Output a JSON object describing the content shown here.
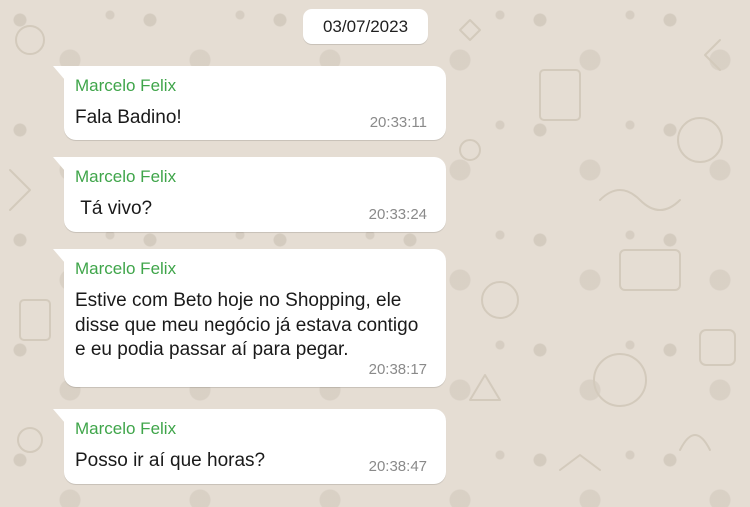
{
  "date_divider": "03/07/2023",
  "messages": [
    {
      "sender": "Marcelo Felix",
      "text": "Fala Badino!",
      "time": "20:33:11"
    },
    {
      "sender": "Marcelo Felix",
      "text": " Tá vivo?",
      "time": "20:33:24"
    },
    {
      "sender": "Marcelo Felix",
      "text": "Estive com Beto hoje no Shopping, ele disse que meu negócio já estava contigo e eu podia passar aí para pegar.",
      "time": "20:38:17"
    },
    {
      "sender": "Marcelo Felix",
      "text": "Posso ir aí que horas?",
      "time": "20:38:47"
    }
  ],
  "colors": {
    "background": "#e5ddd3",
    "bubble": "#ffffff",
    "sender_name": "#3fa54a",
    "timestamp": "#8a8a8a"
  }
}
